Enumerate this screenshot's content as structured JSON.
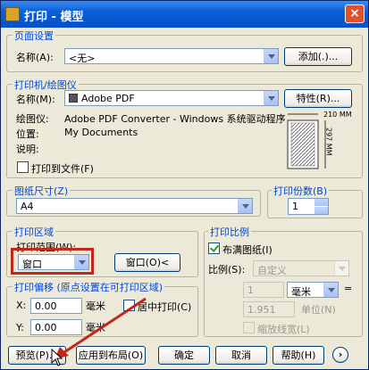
{
  "window": {
    "title": "打印 - 模型",
    "close_glyph": "×"
  },
  "page_setup": {
    "group_label": "页面设置",
    "name_label": "名称(A):",
    "name_value": "<无>",
    "add_button": "添加(.)..."
  },
  "printer": {
    "group_label": "打印机/绘图仪",
    "name_label": "名称(M):",
    "name_value": "Adobe PDF",
    "properties_button": "特性(R)...",
    "plotter_label": "绘图仪:",
    "plotter_value": "Adobe PDF Converter - Windows 系统驱动程序 ...",
    "location_label": "位置:",
    "location_value": "My Documents",
    "description_label": "说明:",
    "print_to_file_label": "打印到文件(F)",
    "print_to_file_checked": false,
    "preview": {
      "width_label": "210 MM",
      "height_label": "297 MM"
    }
  },
  "paper_size": {
    "group_label": "图纸尺寸(Z)",
    "value": "A4"
  },
  "copies": {
    "group_label": "打印份数(B)",
    "value": "1"
  },
  "plot_area": {
    "group_label": "打印区域",
    "range_label": "打印范围(W):",
    "range_value": "窗口",
    "window_button": "窗口(O)<"
  },
  "plot_offset": {
    "group_label": "打印偏移 (原点设置在可打印区域)",
    "x_label": "X:",
    "x_value": "0.00",
    "x_unit": "毫米",
    "y_label": "Y:",
    "y_value": "0.00",
    "y_unit": "毫米",
    "center_label": "居中打印(C)",
    "center_checked": false
  },
  "plot_scale": {
    "group_label": "打印比例",
    "fit_label": "布满图纸(I)",
    "fit_checked": true,
    "scale_label": "比例(S):",
    "scale_value": "自定义",
    "value1": "1",
    "unit1": "毫米",
    "value2": "1.951",
    "unit2": "单位(N)",
    "lineweight_label": "缩放线宽(L)",
    "lineweight_checked": false
  },
  "footer": {
    "preview_button": "预览(P)...",
    "apply_layout_button": "应用到布局(O)",
    "ok_button": "确定",
    "cancel_button": "取消",
    "help_button": "帮助(H)",
    "more_options_glyph": "›"
  },
  "accent_colors": {
    "title_bar": "#0a5fd8",
    "group_label": "#0046d5",
    "highlight": "#c0281a"
  }
}
